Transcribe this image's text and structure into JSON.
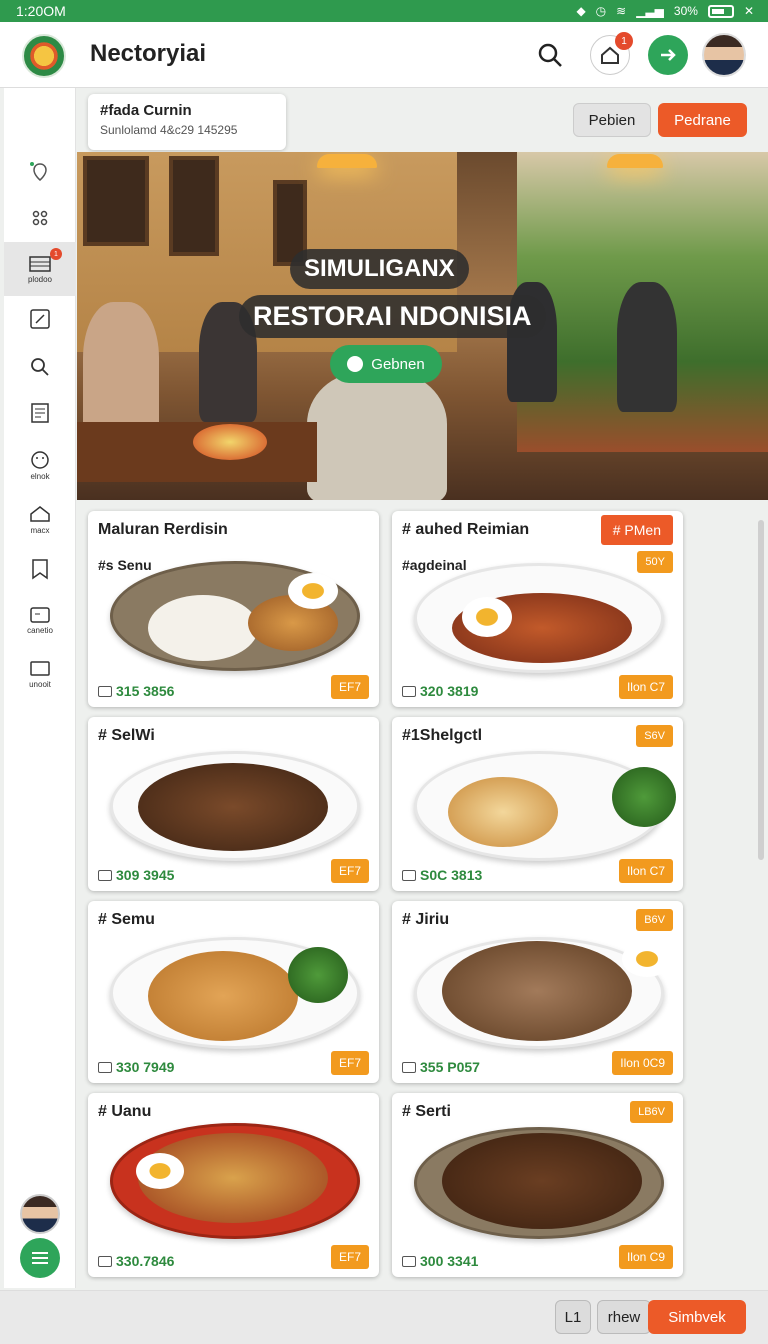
{
  "status": {
    "time": "1:20OM",
    "battery": "30%"
  },
  "app": {
    "title": "Nectoryiai",
    "notification_count": "1"
  },
  "sidebar": {
    "badge": "1",
    "items": [
      {
        "icon": "location-icon",
        "label": ""
      },
      {
        "icon": "grid-icon",
        "label": ""
      },
      {
        "icon": "menu-book-icon",
        "label": "plodoo"
      },
      {
        "icon": "edit-icon",
        "label": ""
      },
      {
        "icon": "search-icon",
        "label": ""
      },
      {
        "icon": "receipt-icon",
        "label": ""
      },
      {
        "icon": "smile-icon",
        "label": "elnok"
      },
      {
        "icon": "home-icon",
        "label": "macx"
      },
      {
        "icon": "bookmark-icon",
        "label": ""
      },
      {
        "icon": "card-icon",
        "label": "canetio"
      },
      {
        "icon": "monitor-icon",
        "label": "unooit"
      }
    ]
  },
  "info_card": {
    "title": "#fada Curnin",
    "subtitle": "Sunlolamd 4&c29 145295"
  },
  "actions": {
    "secondary": "Pebien",
    "primary": "Pedrane"
  },
  "hero": {
    "line1": "SIMULIGANX",
    "line2": "RESTORAI NDONISIA",
    "button": "Gebnen"
  },
  "dishes": [
    {
      "name": "Maluran Rerdisin",
      "sub": "#s Senu",
      "code": "315 3856",
      "price": "EF7",
      "rating": "",
      "promo": ""
    },
    {
      "name": "# auhed Reimian",
      "sub": "#agdeinal",
      "code": "320 3819",
      "price": "Ilon C7",
      "rating": "50Y",
      "promo": "# PMen"
    },
    {
      "name": "# SelWi",
      "sub": "",
      "code": "309 3945",
      "price": "EF7",
      "rating": "",
      "promo": ""
    },
    {
      "name": "#1Shelgctl",
      "sub": "",
      "code": "S0C 3813",
      "price": "Ilon C7",
      "rating": "S6V",
      "promo": ""
    },
    {
      "name": "# Semu",
      "sub": "",
      "code": "330 7949",
      "price": "EF7",
      "rating": "",
      "promo": ""
    },
    {
      "name": "# Jiriu",
      "sub": "",
      "code": "355 P057",
      "price": "Ilon 0C9",
      "rating": "B6V",
      "promo": ""
    },
    {
      "name": "# Uanu",
      "sub": "",
      "code": "330.7846",
      "price": "EF7",
      "rating": "",
      "promo": ""
    },
    {
      "name": "# Serti",
      "sub": "",
      "code": "300 3341",
      "price": "Ilon C9",
      "rating": "LB6V",
      "promo": ""
    }
  ],
  "bottom": {
    "btn1": "L1",
    "btn2": "rhew",
    "btn3": "Simbvek"
  }
}
